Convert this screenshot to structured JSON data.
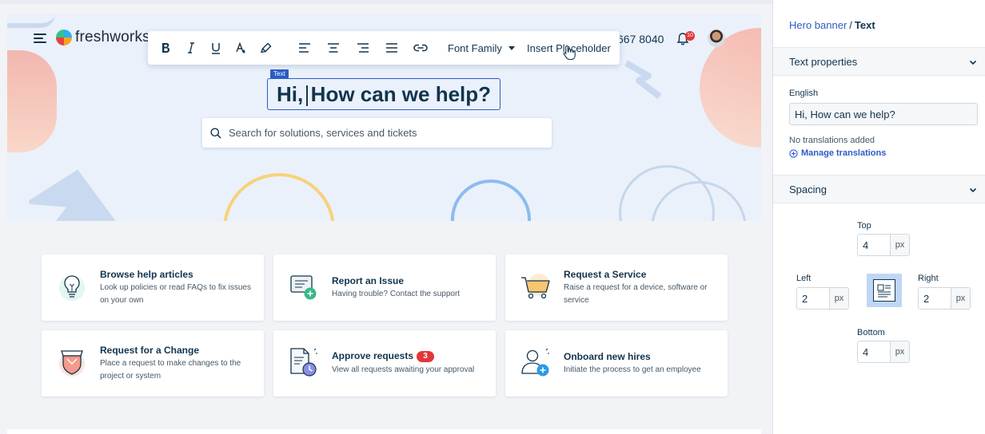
{
  "header": {
    "brand": "freshworks",
    "phone": "667 8040",
    "notification_count": "10"
  },
  "toolbar": {
    "font_family_label": "Font Family",
    "insert_placeholder_label": "Insert Placeholder"
  },
  "hero": {
    "element_tag": "Text",
    "heading_part1": "Hi,",
    "heading_part2": "How can we help?",
    "search_placeholder": "Search for solutions, services and tickets"
  },
  "cards": [
    {
      "title": "Browse help articles",
      "description": "Look up policies or read FAQs to fix issues on your own",
      "icon": "lightbulb-icon"
    },
    {
      "title": "Report an Issue",
      "description": "Having trouble? Contact the support",
      "icon": "report-issue-icon"
    },
    {
      "title": "Request a Service",
      "description": "Raise a request for a device, software or service",
      "icon": "shopping-cart-icon"
    },
    {
      "title": "Request for a Change",
      "description": "Place a request to make changes to the project or system",
      "icon": "shield-icon"
    },
    {
      "title": "Approve requests",
      "description": "View all requests awaiting your approval",
      "badge": "3",
      "icon": "approval-document-icon"
    },
    {
      "title": "Onboard new hires",
      "description": "Initiate the process to get an employee",
      "icon": "add-user-icon"
    }
  ],
  "panel": {
    "breadcrumb_parent": "Hero banner",
    "breadcrumb_separator": "/",
    "breadcrumb_current": "Text",
    "text_properties_label": "Text properties",
    "language_label": "English",
    "text_value": "Hi, How can we help?",
    "no_translations": "No translations added",
    "manage_translations": "Manage translations",
    "spacing_label": "Spacing",
    "top_label": "Top",
    "top_value": "4",
    "left_label": "Left",
    "left_value": "2",
    "right_label": "Right",
    "right_value": "2",
    "bottom_label": "Bottom",
    "bottom_value": "4",
    "unit": "px"
  },
  "colors": {
    "primary_blue": "#2c5cc5",
    "text_dark": "#12344d",
    "hero_bg": "#eaf1fb",
    "badge_red": "#e43538"
  }
}
